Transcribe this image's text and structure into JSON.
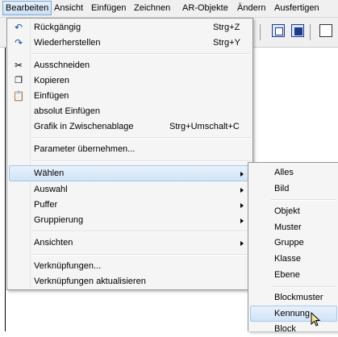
{
  "menubar": {
    "items": [
      "Bearbeiten",
      "Ansicht",
      "Einfügen",
      "Zeichnen",
      "AR-Objekte",
      "Ändern",
      "Ausfertigen"
    ]
  },
  "edit_menu": {
    "items": [
      {
        "label": "Rückgängig",
        "shortcut": "Strg+Z",
        "icon": "undo-icon"
      },
      {
        "label": "Wiederherstellen",
        "shortcut": "Strg+Y",
        "icon": "redo-icon"
      },
      {
        "label": "Ausschneiden",
        "icon": "cut-icon"
      },
      {
        "label": "Kopieren",
        "icon": "copy-icon"
      },
      {
        "label": "Einfügen",
        "icon": "paste-icon"
      },
      {
        "label": "absolut Einfügen"
      },
      {
        "label": "Grafik in Zwischenablage",
        "shortcut": "Strg+Umschalt+C"
      },
      {
        "label": "Parameter übernehmen..."
      },
      {
        "label": "Wählen",
        "submenu": true
      },
      {
        "label": "Auswahl",
        "submenu": true
      },
      {
        "label": "Puffer",
        "submenu": true
      },
      {
        "label": "Gruppierung",
        "submenu": true
      },
      {
        "label": "Ansichten",
        "submenu": true
      },
      {
        "label": "Verknüpfungen..."
      },
      {
        "label": "Verknüpfungen aktualisieren"
      }
    ]
  },
  "waehlen_submenu": {
    "items": [
      "Alles",
      "Bild",
      "Objekt",
      "Muster",
      "Gruppe",
      "Klasse",
      "Ebene",
      "Blockmuster",
      "Kennung",
      "Block"
    ]
  },
  "colors": {
    "highlight": "#d0e4f7",
    "menu_bg": "#f5f5f5"
  }
}
